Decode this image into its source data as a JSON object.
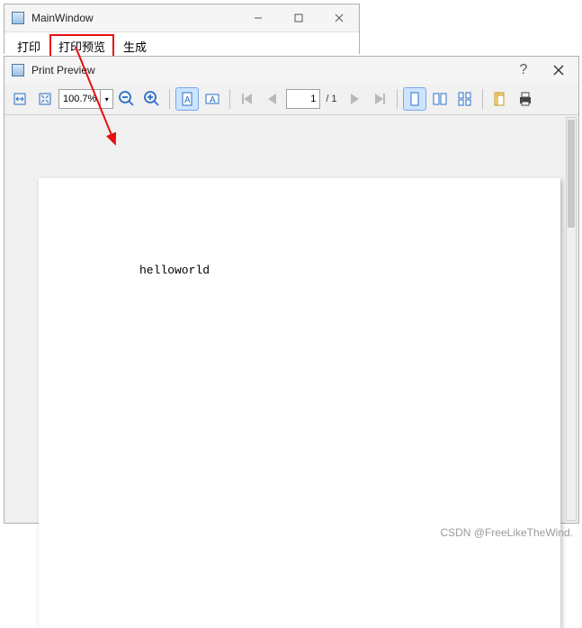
{
  "main_window": {
    "title": "MainWindow",
    "menu": {
      "print": "打印",
      "print_preview": "打印预览",
      "generate": "生成"
    }
  },
  "preview_window": {
    "title": "Print Preview",
    "help": "?",
    "zoom": "100.7%",
    "page_current": "1",
    "page_total": "/ 1",
    "document_text": "helloworld",
    "icons": {
      "fit_width": "fit-width",
      "fit_page": "fit-page",
      "zoom_out": "zoom-out",
      "zoom_in": "zoom-in",
      "portrait": "portrait",
      "landscape": "landscape",
      "first": "first-page",
      "prev": "prev-page",
      "next": "next-page",
      "last": "last-page",
      "single": "single-page",
      "facing": "facing-pages",
      "overview": "overview-pages",
      "page_setup": "page-setup",
      "print": "print"
    }
  },
  "watermark": "CSDN @FreeLikeTheWind."
}
